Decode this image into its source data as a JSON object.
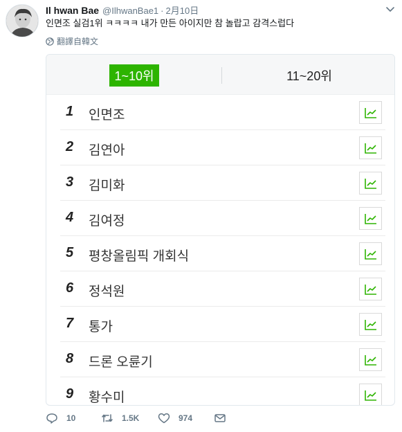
{
  "tweet": {
    "display_name": "Il hwan Bae",
    "handle": "@IlhwanBae1",
    "separator": "·",
    "date": "2月10日",
    "text": "인면조 실검1위 ㅋㅋㅋㅋ 내가 만든 아이지만 참 놀랍고 감격스럽다",
    "translate_label": "翻譯自韓文"
  },
  "card": {
    "tabs": [
      {
        "label": "1~10위",
        "active": true
      },
      {
        "label": "11~20위",
        "active": false
      }
    ],
    "rankings": [
      {
        "rank": "1",
        "keyword": "인면조"
      },
      {
        "rank": "2",
        "keyword": "김연아"
      },
      {
        "rank": "3",
        "keyword": "김미화"
      },
      {
        "rank": "4",
        "keyword": "김여정"
      },
      {
        "rank": "5",
        "keyword": "평창올림픽 개회식"
      },
      {
        "rank": "6",
        "keyword": "정석원"
      },
      {
        "rank": "7",
        "keyword": "통가"
      },
      {
        "rank": "8",
        "keyword": "드론 오륜기"
      },
      {
        "rank": "9",
        "keyword": "황수미"
      }
    ],
    "accent_color": "#2db400"
  },
  "actions": {
    "reply_count": "10",
    "retweet_count": "1.5K",
    "like_count": "974",
    "icons": [
      "reply-icon",
      "retweet-icon",
      "heart-icon",
      "envelope-icon"
    ]
  }
}
